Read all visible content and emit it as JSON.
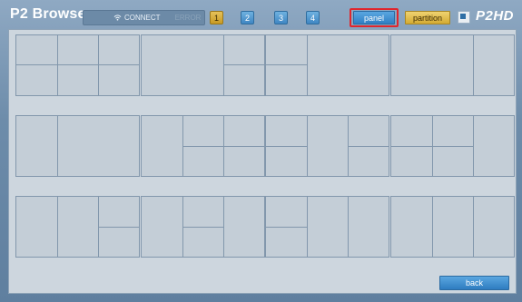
{
  "header": {
    "app_title": "P2 Browser",
    "status_connect": "CONNECT",
    "status_error": "ERROR",
    "page_buttons": [
      "1",
      "2",
      "3",
      "4"
    ],
    "active_page": "1",
    "panel_label": "panel",
    "partition_label": "partition",
    "logo_text": "P2HD"
  },
  "footer": {
    "back_label": "back"
  },
  "layout_presets": {
    "count": 12,
    "selected": "none"
  },
  "colors": {
    "accent_blue": "#2f7fc4",
    "accent_gold": "#d4ab33",
    "highlight_red": "#e0262d"
  },
  "icons": [
    "wifi-icon",
    "window-icon"
  ]
}
